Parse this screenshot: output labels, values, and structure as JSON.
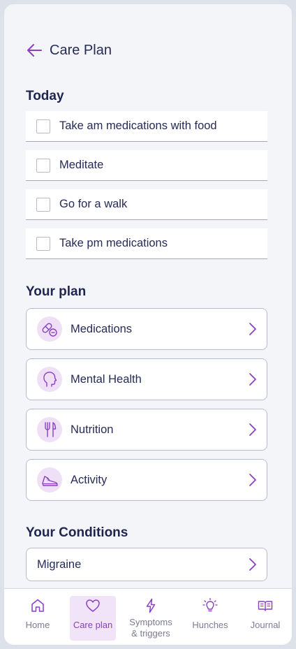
{
  "header": {
    "title": "Care Plan"
  },
  "today": {
    "title": "Today",
    "tasks": [
      {
        "label": "Take am medications with food",
        "checked": false
      },
      {
        "label": "Meditate",
        "checked": false
      },
      {
        "label": "Go for a walk",
        "checked": false
      },
      {
        "label": "Take pm medications",
        "checked": false
      }
    ]
  },
  "plan": {
    "title": "Your plan",
    "items": [
      {
        "label": "Medications",
        "icon": "pills-icon"
      },
      {
        "label": "Mental Health",
        "icon": "head-icon"
      },
      {
        "label": "Nutrition",
        "icon": "fork-knife-icon"
      },
      {
        "label": "Activity",
        "icon": "sneaker-icon"
      }
    ]
  },
  "conditions": {
    "title": "Your Conditions",
    "items": [
      {
        "label": "Migraine"
      }
    ]
  },
  "nav": {
    "items": [
      {
        "label": "Home",
        "icon": "home-icon",
        "active": false
      },
      {
        "label": "Care plan",
        "icon": "heart-icon",
        "active": true
      },
      {
        "label": "Symptoms\n& triggers",
        "icon": "lightning-icon",
        "active": false
      },
      {
        "label": "Hunches",
        "icon": "lightbulb-icon",
        "active": false
      },
      {
        "label": "Journal",
        "icon": "book-icon",
        "active": false
      }
    ]
  },
  "colors": {
    "accent": "#8a3fc4",
    "icon_bg": "#efe0f8",
    "text": "#262b57",
    "background": "#f3f5f8"
  }
}
